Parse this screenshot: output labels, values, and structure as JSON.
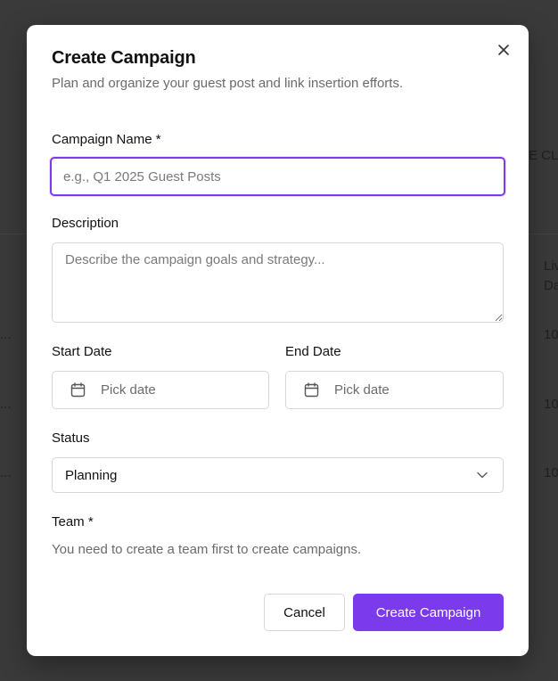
{
  "background": {
    "fragments": [
      "E CL",
      "Liv",
      "Da",
      "10",
      "10",
      "10",
      "...",
      "...",
      "..."
    ]
  },
  "modal": {
    "title": "Create Campaign",
    "subtitle": "Plan and organize your guest post and link insertion efforts.",
    "close_icon": "close-icon",
    "campaign_name": {
      "label": "Campaign Name *",
      "placeholder": "e.g., Q1 2025 Guest Posts",
      "value": ""
    },
    "description": {
      "label": "Description",
      "placeholder": "Describe the campaign goals and strategy...",
      "value": ""
    },
    "start_date": {
      "label": "Start Date",
      "button_text": "Pick date",
      "icon": "calendar-icon"
    },
    "end_date": {
      "label": "End Date",
      "button_text": "Pick date",
      "icon": "calendar-icon"
    },
    "status": {
      "label": "Status",
      "selected": "Planning",
      "icon": "chevron-down-icon"
    },
    "team": {
      "label": "Team *",
      "note": "You need to create a team first to create campaigns."
    },
    "actions": {
      "cancel_label": "Cancel",
      "submit_label": "Create Campaign"
    }
  },
  "colors": {
    "accent": "#7c3aed",
    "backdrop": "#3a3a3a",
    "muted_text": "#6b6b6b",
    "border": "#d6d6d6"
  }
}
